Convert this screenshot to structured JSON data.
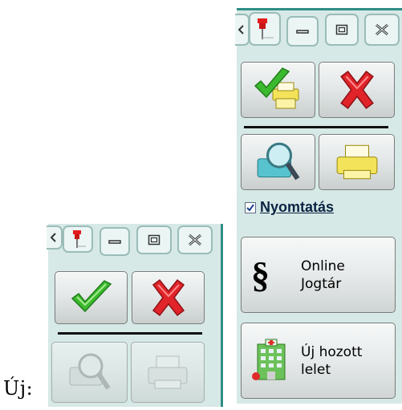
{
  "caption": "Új:",
  "titlebar": {
    "icons": [
      "partial-arrow-icon",
      "pin-icon",
      "minimize-icon",
      "restore-icon",
      "close-icon"
    ]
  },
  "small_panel": {
    "buttons": [
      {
        "icon": "checkmark-icon",
        "enabled": true
      },
      {
        "icon": "red-x-icon",
        "enabled": true
      },
      {
        "icon": "print-preview-icon",
        "enabled": false
      },
      {
        "icon": "printer-icon",
        "enabled": false
      }
    ]
  },
  "large_panel": {
    "buttons": [
      {
        "icon": "check-printer-icon",
        "enabled": true
      },
      {
        "icon": "red-x-icon",
        "enabled": true
      },
      {
        "icon": "print-preview-icon",
        "enabled": true
      },
      {
        "icon": "printer-icon",
        "enabled": true
      }
    ],
    "print_checkbox": {
      "label": "Nyomtatás",
      "checked": true
    },
    "online_button": {
      "label": "Online\nJogtár",
      "icon_text": "§"
    },
    "new_button": {
      "label": "Új hozott\nlelet",
      "icon": "hospital-building-icon"
    }
  },
  "colors": {
    "panel_bg": "#d6e9e6",
    "accent": "#2f8e86",
    "check_green": "#3cba2f",
    "x_red": "#e0242a",
    "printer_yellow": "#f3e35a"
  }
}
